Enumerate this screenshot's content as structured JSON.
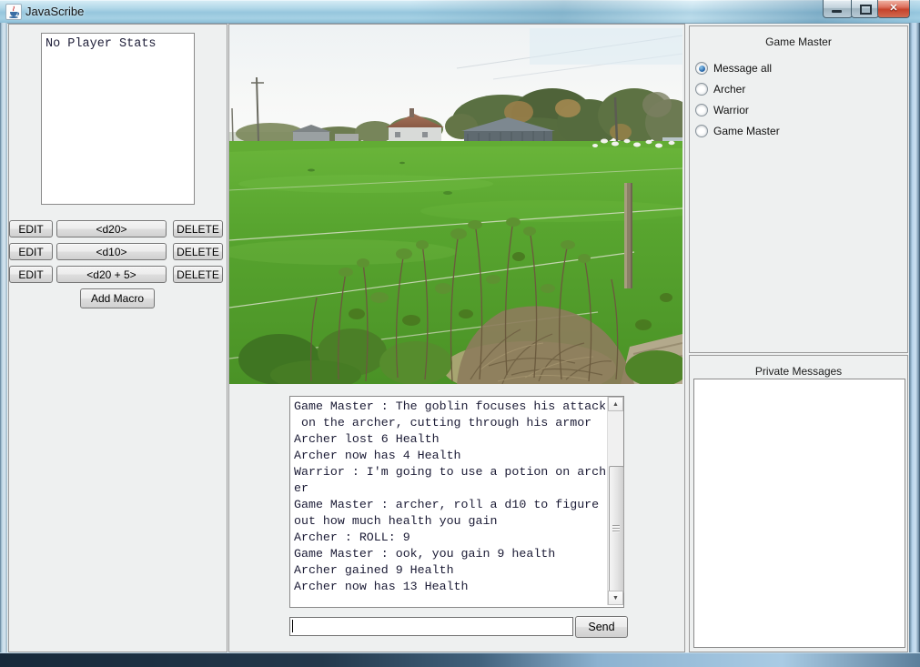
{
  "window": {
    "title": "JavaScribe",
    "close_glyph": "✕"
  },
  "icons": {
    "scroll_up": "▲",
    "scroll_down": "▼"
  },
  "stats": {
    "text": "No Player Stats"
  },
  "macros": {
    "rows": [
      {
        "edit": "EDIT",
        "macro": "<d20>",
        "delete": "DELETE"
      },
      {
        "edit": "EDIT",
        "macro": "<d10>",
        "delete": "DELETE"
      },
      {
        "edit": "EDIT",
        "macro": "<d20 + 5>",
        "delete": "DELETE"
      }
    ],
    "add_label": "Add Macro"
  },
  "photo": {
    "description": "autumn pasture with farm buildings, hedgerow trees, wire fence and dried brambles"
  },
  "chat": {
    "log": "Game Master : The goblin focuses his attack\n on the archer, cutting through his armor\nArcher lost 6 Health\nArcher now has 4 Health\nWarrior : I'm going to use a potion on arch\ner\nGame Master : archer, roll a d10 to figure\nout how much health you gain\nArcher : ROLL: 9\nGame Master : ook, you gain 9 health\nArcher gained 9 Health\nArcher now has 13 Health",
    "input_value": "",
    "send_label": "Send"
  },
  "right_panel": {
    "title": "Game Master",
    "radios": [
      {
        "label": "Message all",
        "selected": true
      },
      {
        "label": "Archer",
        "selected": false
      },
      {
        "label": "Warrior",
        "selected": false
      },
      {
        "label": "Game Master",
        "selected": false
      }
    ],
    "private_title": "Private Messages",
    "private_content": ""
  },
  "colors": {
    "titlebar_blue": "#a6d1e4",
    "close_red": "#c6432c",
    "radio_selected_blue": "#2d6daf",
    "panel_gray": "#eef0f0",
    "border_gray": "#9b9b9b",
    "field_green": "#55a02c",
    "chat_text": "#1b1b35"
  }
}
